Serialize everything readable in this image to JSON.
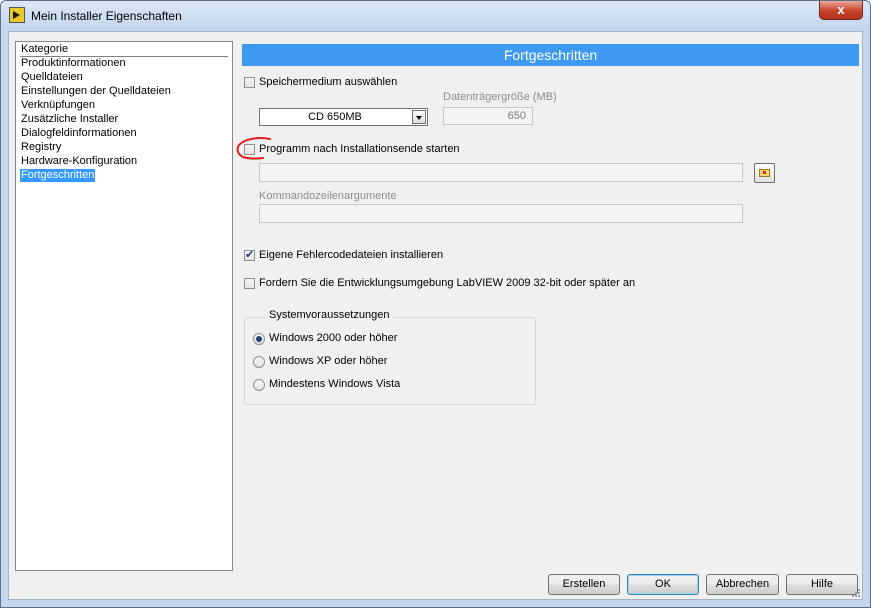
{
  "window": {
    "title": "Mein Installer Eigenschaften",
    "close_label": "x"
  },
  "category_list": {
    "header": "Kategorie",
    "items": [
      "Produktinformationen",
      "Quelldateien",
      "Einstellungen der Quelldateien",
      "Verknüpfungen",
      "Zusätzliche Installer",
      "Dialogfeldinformationen",
      "Registry",
      "Hardware-Konfiguration",
      "Fortgeschritten"
    ],
    "selected": "Fortgeschritten"
  },
  "panel": {
    "title": "Fortgeschritten",
    "storage": {
      "checkbox_label": "Speichermedium auswählen",
      "checked": false,
      "select_value": "CD 650MB",
      "size_label": "Datenträgergröße (MB)",
      "size_value": "650"
    },
    "run_program": {
      "checkbox_label": "Programm nach Installationsende starten",
      "checked": false,
      "path_value": "",
      "args_label": "Kommandozeilenargumente",
      "args_value": ""
    },
    "error_files": {
      "checkbox_label": "Eigene Fehlercodedateien installieren",
      "checked": true
    },
    "require_labview": {
      "checkbox_label": "Fordern Sie die Entwicklungsumgebung LabVIEW 2009 32-bit oder später an",
      "checked": false
    },
    "system_requirements": {
      "title": "Systemvoraussetzungen",
      "options": [
        "Windows 2000 oder höher",
        "Windows XP oder höher",
        "Mindestens Windows Vista"
      ],
      "selected_index": 0
    }
  },
  "buttons": {
    "build": "Erstellen",
    "ok": "OK",
    "cancel": "Abbrechen",
    "help": "Hilfe"
  },
  "colors": {
    "header_blue": "#3d9af0",
    "selection_blue": "#3399ff",
    "annotation_red": "#e02020",
    "close_red": "#c7432a"
  }
}
